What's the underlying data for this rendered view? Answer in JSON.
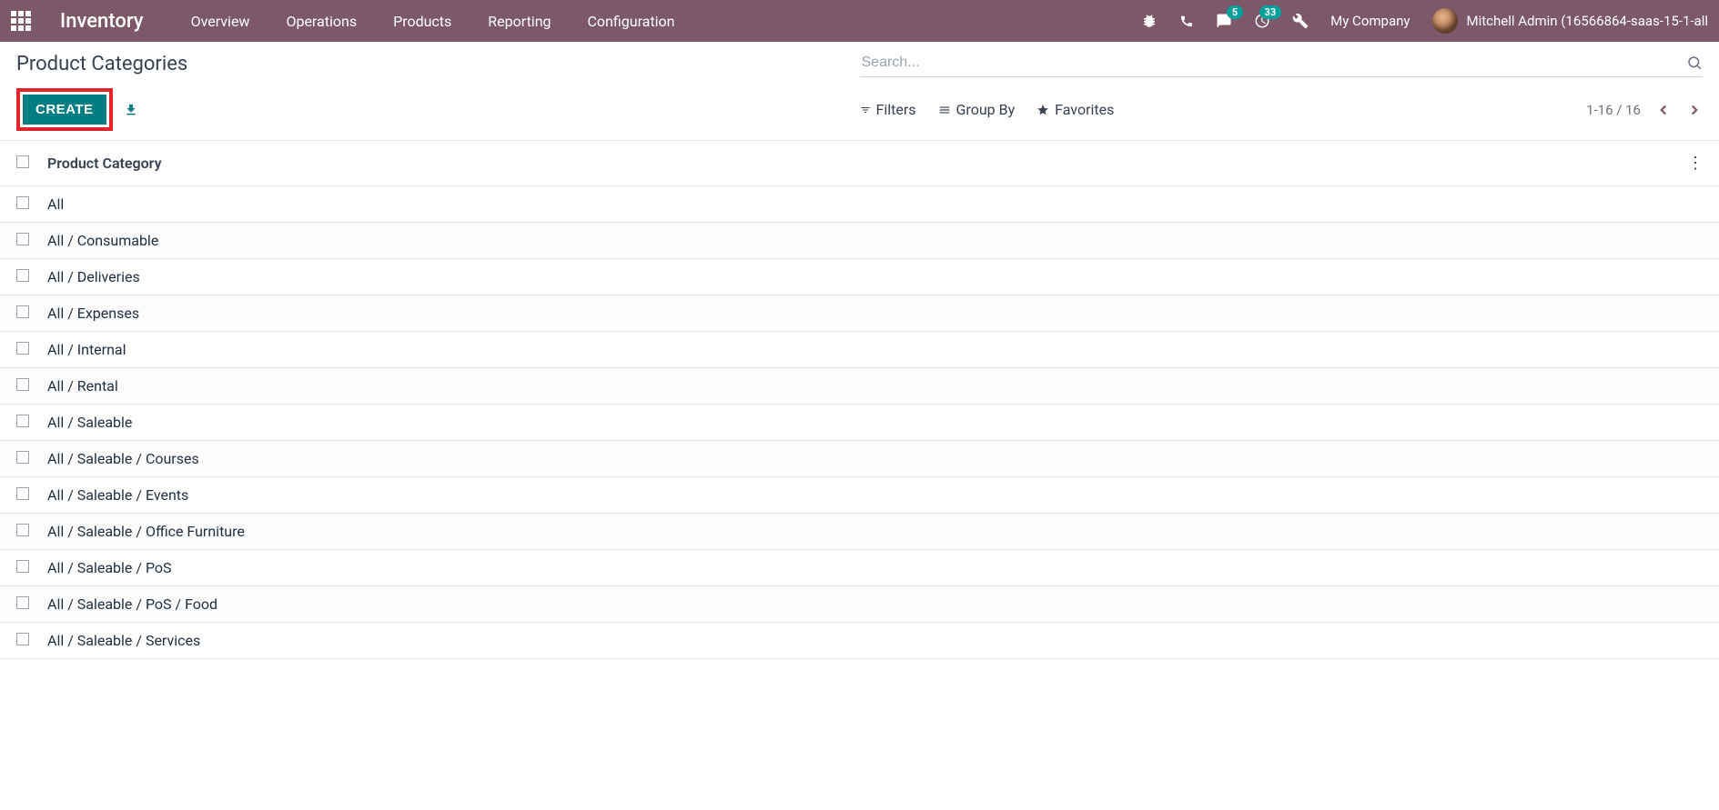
{
  "navbar": {
    "brand": "Inventory",
    "menu": [
      "Overview",
      "Operations",
      "Products",
      "Reporting",
      "Configuration"
    ],
    "messages_badge": "5",
    "activities_badge": "33",
    "company": "My Company",
    "user": "Mitchell Admin (16566864-saas-15-1-all"
  },
  "control_panel": {
    "title": "Product Categories",
    "search_placeholder": "Search...",
    "create_label": "CREATE",
    "filters_label": "Filters",
    "groupby_label": "Group By",
    "favorites_label": "Favorites",
    "pager": "1-16 / 16"
  },
  "list": {
    "column_header": "Product Category",
    "rows": [
      "All",
      "All / Consumable",
      "All / Deliveries",
      "All / Expenses",
      "All / Internal",
      "All / Rental",
      "All / Saleable",
      "All / Saleable / Courses",
      "All / Saleable / Events",
      "All / Saleable / Office Furniture",
      "All / Saleable / PoS",
      "All / Saleable / PoS / Food",
      "All / Saleable / Services"
    ]
  }
}
